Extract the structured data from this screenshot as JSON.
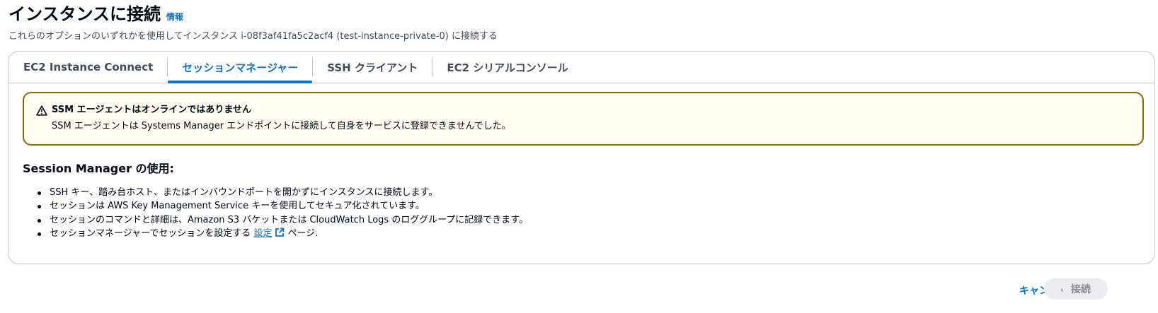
{
  "header": {
    "title": "インスタンスに接続",
    "info_link": "情報",
    "subtitle": "これらのオプションのいずれかを使用してインスタンス i-08f3af41fa5c2acf4 (test-instance-private-0) に接続する"
  },
  "tabs": [
    {
      "label": "EC2 Instance Connect",
      "active": false
    },
    {
      "label": "セッションマネージャー",
      "active": true
    },
    {
      "label": "SSH クライアント",
      "active": false
    },
    {
      "label": "EC2 シリアルコンソール",
      "active": false
    }
  ],
  "alert": {
    "icon": "warning-icon",
    "title": "SSM エージェントはオンラインではありません",
    "body": "SSM エージェントは Systems Manager エンドポイントに接続して自身をサービスに登録できませんでした。",
    "border_color": "#8d6605",
    "background": "#fffef0"
  },
  "session_manager": {
    "title": "Session Manager の使用:",
    "bullets": [
      "SSH キー、踏み台ホスト、またはインバウンドポートを開かずにインスタンスに接続します。",
      "セッションは AWS Key Management Service キーを使用してセキュア化されています。",
      "セッションのコマンドと詳細は、Amazon S3 バケットまたは CloudWatch Logs のロググループに記録できます。"
    ],
    "last_bullet_prefix": "セッションマネージャーでセッションを設定する",
    "last_bullet_link": "設定",
    "last_bullet_suffix": "ページ."
  },
  "footer": {
    "cancel_label": "キャンセル",
    "connect_label": "接続",
    "connect_disabled": true
  },
  "colors": {
    "accent": "#0972d3",
    "text": "#000716",
    "muted": "#414d5c"
  }
}
